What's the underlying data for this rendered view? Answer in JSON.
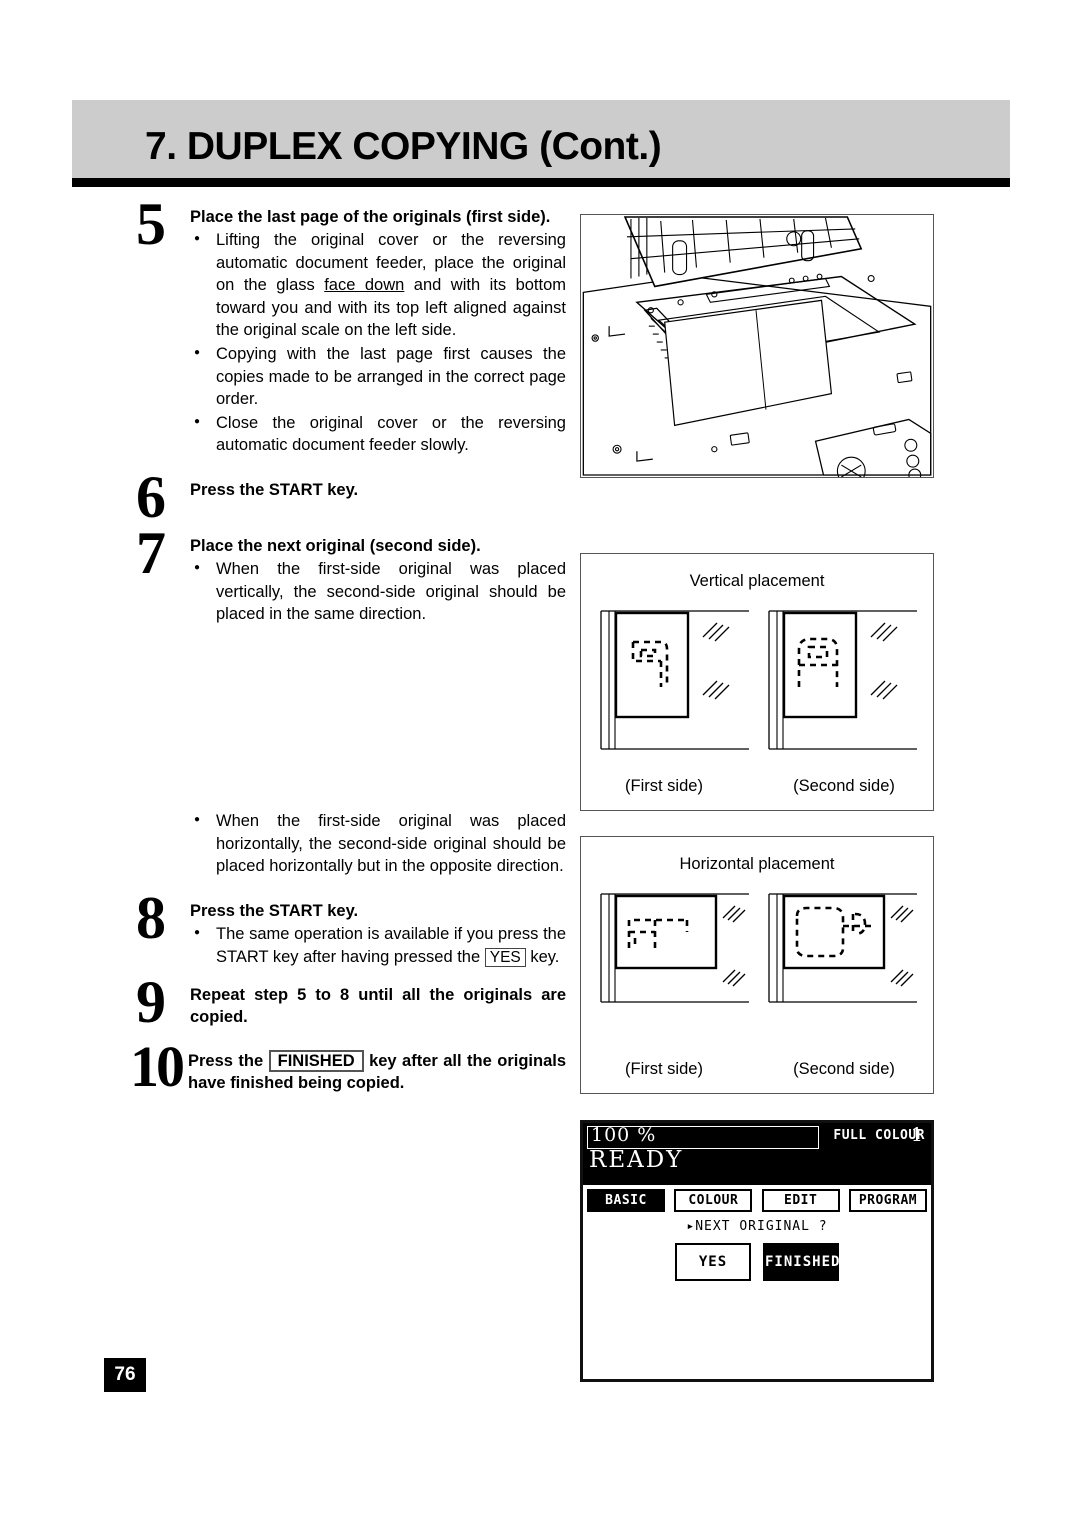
{
  "header": {
    "title": "7. DUPLEX COPYING (Cont.)",
    "band_color": "#cccccc"
  },
  "steps": [
    {
      "number": "5",
      "title": "Place the last page of the originals (first side).",
      "bullets": [
        "Lifting the original cover or the reversing automatic document feeder, place the original on the glass face down and with its bottom toward you and with its top left aligned against the original scale on the left side.",
        "Copying with the last page first causes the copies made to be arranged in the correct page order.",
        "Close the original cover or the reversing automatic document feeder slowly."
      ]
    },
    {
      "number": "6",
      "title": "Press the START key.",
      "bullets": []
    },
    {
      "number": "7",
      "title": "Place the next original (second side).",
      "bullets": [
        "When the first-side original was placed vertically, the second-side original should be placed in the same direction.",
        "When the first-side original was placed horizontally, the second-side original should be placed horizontally but in the opposite direction."
      ]
    },
    {
      "number": "8",
      "title": "Press the START key.",
      "bullets": [
        "The same operation is available if you press the START key after having pressed the YES key."
      ],
      "inline_key": "YES"
    },
    {
      "number": "9",
      "title": "Repeat step 5 to 8 until all the originals are copied.",
      "bullets": []
    },
    {
      "number": "10",
      "title_before": "Press the",
      "inline_key": "FINISHED",
      "title_after": "key after all the originals have finished being copied.",
      "bullets": []
    }
  ],
  "text_fragments": {
    "step5_b1_l1": "Lifting the original cover or the reversing",
    "step5_b1_l2": "automatic document feeder, place the original",
    "step5_b1_l3a": "on the glass ",
    "step5_b1_l3b": "face down",
    "step5_b1_l3c": " and with its bottom",
    "step5_b1_l4": "toward you and with its top left aligned against",
    "step5_b1_l5": "the original scale on the left side.",
    "step5_b2_l1": "Copying with the last page first causes the",
    "step5_b2_l2": "copies made to be arranged in the correct",
    "step5_b2_l3": "page order.",
    "step5_b3_l1": "Close the original cover or the reversing",
    "step5_b3_l2": "automatic document feeder slowly.",
    "step7_b1_l1": "When the first-side original was placed",
    "step7_b1_l2": "vertically, the second-side original should be",
    "step7_b1_l3": "placed in the same direction.",
    "step7_b2_l1": "When the first-side original was placed",
    "step7_b2_l2": "horizontally, the second-side original should",
    "step7_b2_l3": "be placed horizontally but in the opposite",
    "step7_b2_l4": "direction.",
    "step8_b1_l1": "The same operation is available if you press",
    "step8_b1_l2a": "the START key after having pressed the ",
    "step8_b1_l3": "key.",
    "step9_l1": "Repeat step 5 to 8 until all the originals are",
    "step9_l2": "copied.",
    "step10_l1a": "Press the",
    "step10_l1b": "key after all the",
    "step10_l2": "originals have finished being copied."
  },
  "diagrams": {
    "photo_caption": "",
    "vertical": {
      "caption": "Vertical placement",
      "first_label": "(First side)",
      "second_label": "(Second side)"
    },
    "horizontal": {
      "caption": "Horizontal placement",
      "first_label": "(First side)",
      "second_label": "(Second side)"
    }
  },
  "lcd": {
    "zoom": "100 %",
    "copies": "1",
    "colour_mode": "FULL COLOUR",
    "status": "READY",
    "tabs": [
      {
        "label": "BASIC",
        "active": true
      },
      {
        "label": "COLOUR",
        "active": false
      },
      {
        "label": "EDIT",
        "active": false
      },
      {
        "label": "PROGRAM",
        "active": false
      }
    ],
    "prompt": "▸NEXT ORIGINAL ?",
    "keys": [
      {
        "label": "YES",
        "active": false
      },
      {
        "label": "FINISHED",
        "active": true
      }
    ]
  },
  "footer": {
    "page_number": "76"
  }
}
